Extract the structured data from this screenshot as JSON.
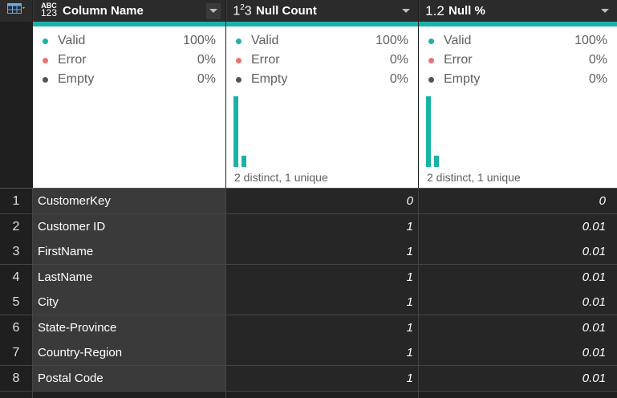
{
  "columns": [
    {
      "type_icon": "ABC 123",
      "name": "Column Name",
      "stats": [],
      "distinct": ""
    },
    {
      "type_icon": "1²3",
      "name": "Null Count",
      "distinct": "2 distinct, 1 unique"
    },
    {
      "type_icon": "1.2",
      "name": "Null %",
      "distinct": "2 distinct, 1 unique"
    }
  ],
  "quality": {
    "col1": {
      "valid_label": "Valid",
      "valid_pct": "100%",
      "error_label": "Error",
      "error_pct": "0%",
      "empty_label": "Empty",
      "empty_pct": "0%"
    },
    "col2": {
      "valid_label": "Valid",
      "valid_pct": "100%",
      "error_label": "Error",
      "error_pct": "0%",
      "empty_label": "Empty",
      "empty_pct": "0%"
    },
    "col3": {
      "valid_label": "Valid",
      "valid_pct": "100%",
      "error_label": "Error",
      "error_pct": "0%",
      "empty_label": "Empty",
      "empty_pct": "0%"
    }
  },
  "colors": {
    "valid": "#1ab2a8",
    "error": "#f07070",
    "empty": "#555555",
    "accent": "#1ab2a8"
  },
  "distribution": {
    "col2": [
      {
        "value": "1",
        "count": 7
      },
      {
        "value": "0",
        "count": 1
      }
    ],
    "col3": [
      {
        "value": "0.01",
        "count": 7
      },
      {
        "value": "0",
        "count": 1
      }
    ]
  },
  "rows": [
    {
      "index": "1",
      "name": "CustomerKey",
      "null_count": "0",
      "null_pct": "0"
    },
    {
      "index": "2",
      "name": "Customer ID",
      "null_count": "1",
      "null_pct": "0.01"
    },
    {
      "index": "3",
      "name": "FirstName",
      "null_count": "1",
      "null_pct": "0.01"
    },
    {
      "index": "4",
      "name": "LastName",
      "null_count": "1",
      "null_pct": "0.01"
    },
    {
      "index": "5",
      "name": "City",
      "null_count": "1",
      "null_pct": "0.01"
    },
    {
      "index": "6",
      "name": "State-Province",
      "null_count": "1",
      "null_pct": "0.01"
    },
    {
      "index": "7",
      "name": "Country-Region",
      "null_count": "1",
      "null_pct": "0.01"
    },
    {
      "index": "8",
      "name": "Postal Code",
      "null_count": "1",
      "null_pct": "0.01"
    }
  ]
}
